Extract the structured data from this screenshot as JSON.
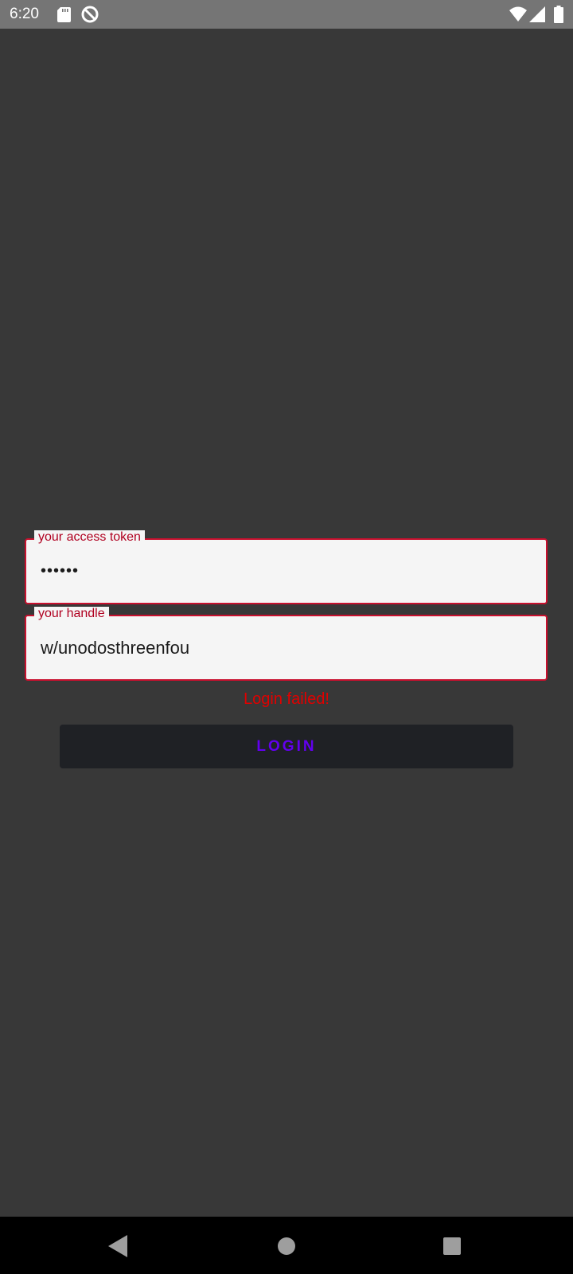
{
  "status_bar": {
    "time": "6:20",
    "icons": [
      "sd-card-icon",
      "do-not-disturb-icon",
      "wifi-icon",
      "cell-signal-icon",
      "battery-icon"
    ]
  },
  "login_form": {
    "token_field": {
      "label": "your access token",
      "value": "••••••"
    },
    "handle_field": {
      "label": "your handle",
      "value": "w/unodosthreenfou"
    },
    "error_message": "Login failed!",
    "login_button_label": "LOGIN"
  },
  "nav_bar": {
    "icons": [
      "back-icon",
      "home-icon",
      "recents-icon"
    ]
  },
  "colors": {
    "background": "#383838",
    "status_bar": "#757575",
    "error": "#e00000",
    "field_border": "#c8102e",
    "button_text": "#6200ee",
    "button_bg": "#1f2125"
  }
}
